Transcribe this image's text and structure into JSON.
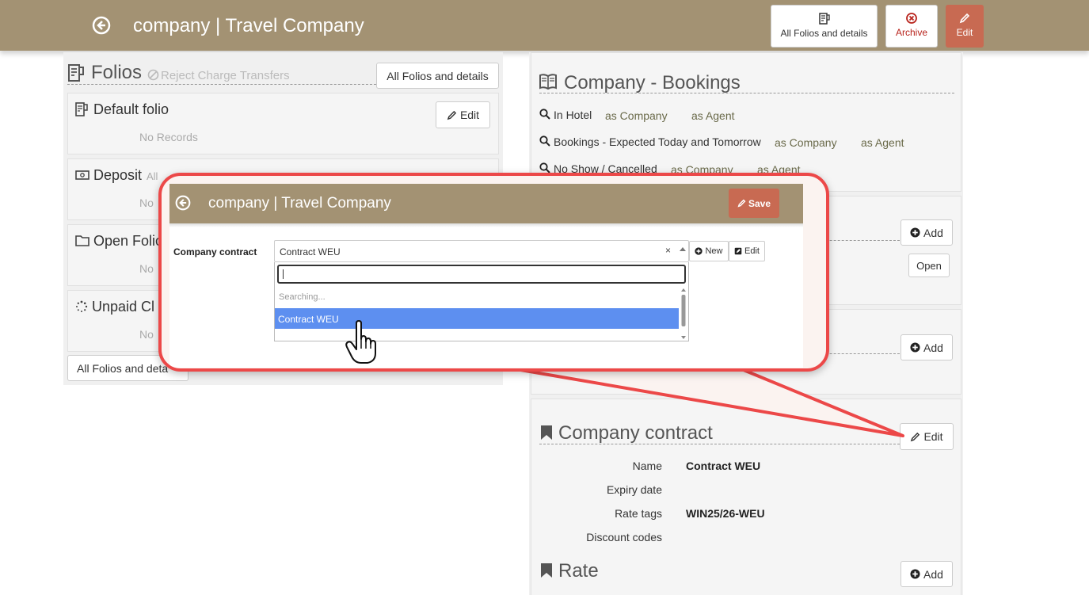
{
  "topbar": {
    "title": "company | Travel Company",
    "all_folios_label": "All Folios and details",
    "archive_label": "Archive",
    "edit_label": "Edit"
  },
  "folios": {
    "title": "Folios",
    "reject_label": "Reject Charge Transfers",
    "header_button": "All Folios and details",
    "default_folio": {
      "title": "Default folio",
      "edit_label": "Edit",
      "empty": "No Records"
    },
    "deposit": {
      "title": "Deposit",
      "subtitle": "All",
      "empty": "No"
    },
    "open_folios": {
      "title": "Open Folio",
      "empty": "No"
    },
    "unpaid": {
      "title": "Unpaid Cl",
      "empty": "No"
    },
    "footer_button": "All Folios and deta"
  },
  "bookings": {
    "title": "Company - Bookings",
    "rows": [
      {
        "label": "In Hotel",
        "as_company": "as Company",
        "as_agent": "as Agent"
      },
      {
        "label": "Bookings - Expected Today and Tomorrow",
        "as_company": "as Company",
        "as_agent": "as Agent"
      },
      {
        "label": "No Show / Cancelled",
        "as_company": "as Company",
        "as_agent": "as Agent"
      }
    ]
  },
  "middle": {
    "add_label": "Add",
    "open_label": "Open",
    "add2_label": "Add"
  },
  "contract": {
    "title": "Company contract",
    "edit_label": "Edit",
    "name_label": "Name",
    "name_value": "Contract WEU",
    "expiry_label": "Expiry date",
    "rate_tags_label": "Rate tags",
    "rate_tags_value": "WIN25/26-WEU",
    "discount_label": "Discount codes"
  },
  "rate": {
    "title": "Rate",
    "add_label": "Add"
  },
  "callout": {
    "title": "company | Travel Company",
    "save_label": "Save",
    "field_label": "Company contract",
    "selected_value": "Contract WEU",
    "clear": "×",
    "new_label": "New",
    "edit_label": "Edit",
    "searching": "Searching...",
    "option": "Contract WEU"
  },
  "colors": {
    "topbar": "#a39273",
    "accent": "#c86a52",
    "callout_border": "#ec4848",
    "highlight": "#5d8ff0"
  }
}
